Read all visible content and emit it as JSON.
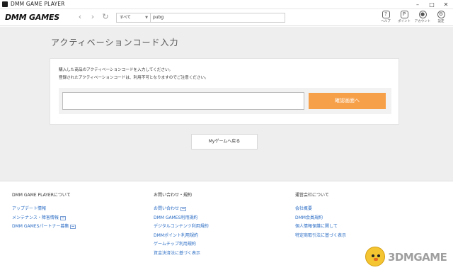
{
  "window": {
    "title": "DMM GAME PLAYER",
    "controls": [
      "–",
      "□",
      "✕"
    ]
  },
  "toolbar": {
    "logo": "DMM GAMES",
    "back": "‹",
    "forward": "›",
    "reload": "↻",
    "search": {
      "category": "すべて",
      "value": "pubg"
    },
    "help_label": "ヘルプ",
    "point_label": "ポイント",
    "account_label": "アカウント",
    "settings_label": "設定"
  },
  "main": {
    "title": "アクティベーションコード入力",
    "desc_line1": "購入した商品のアクティベーションコードを入力してください。",
    "desc_line2": "登録されたアクティベーションコードは、利用不可となりますのでご注意ください。",
    "confirm_label": "確認画面へ",
    "back_label": "Myゲームへ戻る"
  },
  "footer": {
    "col1": {
      "heading": "DMM GAME PLAYERについて",
      "links": [
        "アップデート情報",
        "メンテナンス・障害情報",
        "DMM GAMESパートナー募集"
      ]
    },
    "col2": {
      "heading": "お問い合わせ・規約",
      "links": [
        "お問い合わせ",
        "DMM GAMES利用規約",
        "デジタルコンテンツ利用規約",
        "DMMポイント利用規約",
        "ゲームチップ利用規約",
        "資金決済法に基づく表示"
      ]
    },
    "col3": {
      "heading": "運営会社について",
      "links": [
        "会社概要",
        "DMM会員規約",
        "個人情報保護に関して",
        "特定商取引法に基づく表示"
      ]
    }
  },
  "watermark": {
    "text": "3DMGAME"
  }
}
